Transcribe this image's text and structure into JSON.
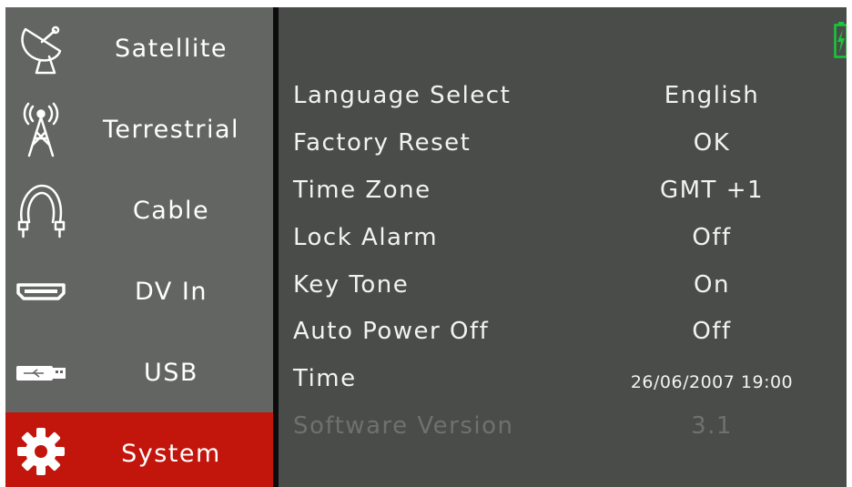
{
  "sidebar": {
    "items": [
      {
        "label": "Satellite",
        "icon": "satellite-dish-icon"
      },
      {
        "label": "Terrestrial",
        "icon": "antenna-tower-icon"
      },
      {
        "label": "Cable",
        "icon": "coax-cable-icon"
      },
      {
        "label": "DV In",
        "icon": "hdmi-port-icon"
      },
      {
        "label": "USB",
        "icon": "usb-stick-icon"
      },
      {
        "label": "System",
        "icon": "gear-icon",
        "active": true
      }
    ]
  },
  "settings": {
    "rows": [
      {
        "label": "Language Select",
        "value": "English"
      },
      {
        "label": "Factory Reset",
        "value": "OK"
      },
      {
        "label": "Time Zone",
        "value": "GMT +1"
      },
      {
        "label": "Lock Alarm",
        "value": "Off"
      },
      {
        "label": "Key Tone",
        "value": "On"
      },
      {
        "label": "Auto Power Off",
        "value": "Off"
      },
      {
        "label": "Time",
        "value": "26/06/2007 19:00"
      },
      {
        "label": "Software Version",
        "value": "3.1",
        "disabled": true
      }
    ]
  },
  "status": {
    "battery_icon": "battery-charging-icon"
  },
  "colors": {
    "sidebar_bg": "#636563",
    "active_item": "#c2150c",
    "panel_bg": "#4a4c4a",
    "text": "#f2f2f2",
    "disabled_text": "#6f716f",
    "battery": "#18c83a"
  }
}
